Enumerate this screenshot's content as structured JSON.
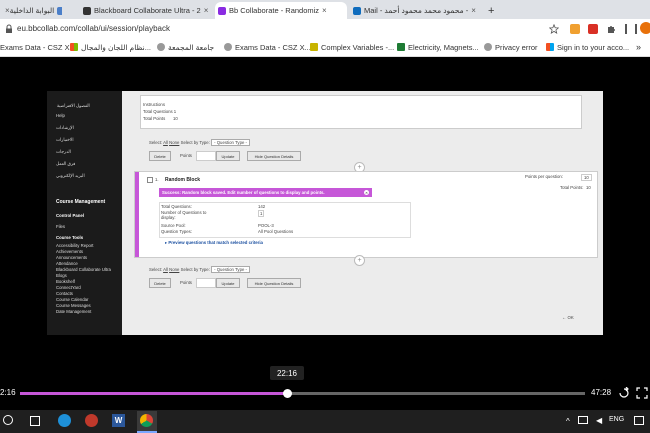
{
  "browser": {
    "tabs": [
      {
        "label": "البوابة الداخلية",
        "active": false,
        "favicon_color": "#4b7fc9"
      },
      {
        "label": "Blackboard Collaborate Ultra - 2",
        "active": false,
        "favicon_color": "#333333"
      },
      {
        "label": "Bb Collaborate - Randomiz",
        "active": true,
        "favicon_color": "#8a2be2"
      },
      {
        "label": "Mail - محمود محمد محمود أحمد -",
        "active": false,
        "favicon_color": "#0f6cbd"
      }
    ],
    "new_tab_label": "+",
    "url": "eu.bbcollab.com/collab/ui/session/playback",
    "bookmarks": [
      {
        "label": "Exams Data - CSZ X...",
        "icon": "globe-icon"
      },
      {
        "label": "نظام اللجان والمجال...",
        "icon": "ms-icon"
      },
      {
        "label": "جامعة المجمعة",
        "icon": "globe-icon"
      },
      {
        "label": "Exams Data - CSZ X...",
        "icon": "globe-icon"
      },
      {
        "label": "Complex Variables -...",
        "icon": "bm-icon"
      },
      {
        "label": "Electricity, Magnets...",
        "icon": "bm-icon"
      },
      {
        "label": "Privacy error",
        "icon": "globe-icon"
      },
      {
        "label": "Sign in to your acco...",
        "icon": "ms-icon"
      }
    ]
  },
  "lms": {
    "sidebar_top": [
      "الفصول الافتراضية",
      "Help",
      "الإرشادات",
      "الاختبارات",
      "الدرجات",
      "فرق العمل",
      "البريد الإلكتروني"
    ],
    "course_management": "Course Management",
    "control_panel": "Control Panel",
    "files": "Files",
    "course_tools": "Course Tools",
    "tools": [
      "Accessibility Report",
      "Achievements",
      "Announcements",
      "Attendance",
      "Blackboard Collaborate Ultra",
      "Blogs",
      "Bookshelf",
      "ConnectYard",
      "Contacts",
      "Course Calendar",
      "Course Messages",
      "Date Management"
    ],
    "top_panel": {
      "instructions": "Instructions",
      "total_questions": "Total Questions 1",
      "total_points": "Total Points",
      "total_points_value": "10"
    },
    "select_label": "Select:",
    "all": "All",
    "none": "None",
    "select_by_type": "Select by Type:",
    "question_type": "- Question Type -",
    "delete": "Delete",
    "points": "Points",
    "update": "Update",
    "hide_details": "Hide Question Details",
    "random_block": {
      "checkbox_num": "1.",
      "title": "Random Block",
      "points_per_question_label": "Points per question:",
      "points_per_question": "10",
      "total_points_label": "Total Points:",
      "total_points": "10",
      "success_msg": "Success: Random block saved. Edit number of questions to display and points.",
      "fields": [
        {
          "label": "Total Questions:",
          "value": "142"
        },
        {
          "label": "Number of Questions to display:",
          "value": "1"
        },
        {
          "label": "Source Pool:",
          "value": "POOL-3"
        },
        {
          "label": "Question Types:",
          "value": "All Pool Questions"
        }
      ],
      "preview_link": "Preview questions that match selected criteria"
    },
    "ok": "OK"
  },
  "player": {
    "current_time_bubble": "22:16",
    "elapsed": "2:16",
    "duration": "47:28",
    "progress_fraction": 0.474
  },
  "taskbar": {
    "lang": "ENG"
  }
}
